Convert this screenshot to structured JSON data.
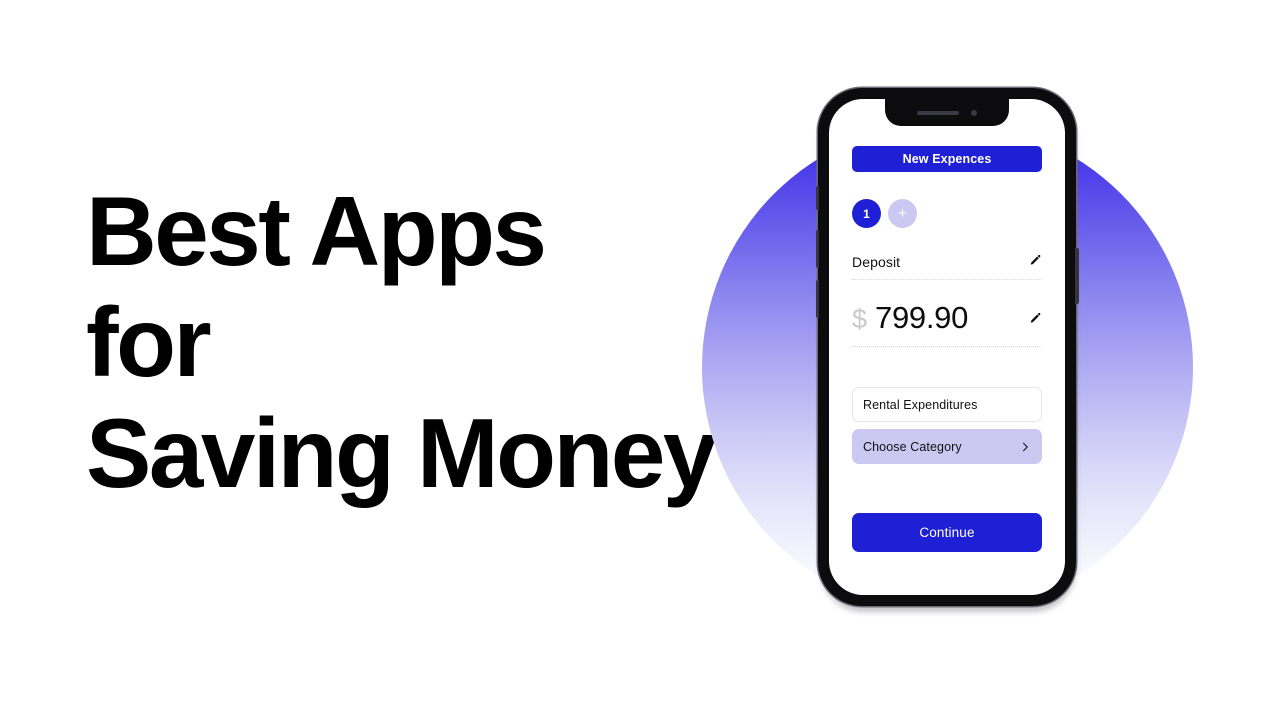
{
  "headline": {
    "text": "Best Apps\nfor\nSaving Money",
    "color": "#000000"
  },
  "backdrop": {
    "shape": "circle",
    "gradient_from": "#3a2ae6",
    "gradient_to": "#ffffff"
  },
  "phone": {
    "frame_color": "#0c0c0e",
    "screen_color": "#ffffff",
    "notch": {
      "speaker_icon": "speaker-grille-icon",
      "camera_icon": "front-camera-icon"
    },
    "side_buttons": [
      {
        "name": "mute-switch"
      },
      {
        "name": "volume-down-button"
      },
      {
        "name": "volume-up-button"
      },
      {
        "name": "power-button"
      }
    ]
  },
  "app": {
    "accent_color": "#1f1fd6",
    "muted_accent_color": "#cbc9f2",
    "header_button": {
      "label": "New Expences"
    },
    "steps": [
      {
        "label": "1",
        "state": "active"
      },
      {
        "label": "+",
        "state": "add"
      }
    ],
    "deposit_field": {
      "label": "Deposit",
      "edit_icon": "pencil-icon"
    },
    "amount_field": {
      "currency": "$",
      "value": "799.90",
      "edit_icon": "pencil-icon"
    },
    "category_input": {
      "value": "Rental Expenditures",
      "placeholder": "Rental Expenditures"
    },
    "choose_category": {
      "label": "Choose Category",
      "chevron_icon": "chevron-right-icon"
    },
    "continue_button": {
      "label": "Continue"
    }
  }
}
